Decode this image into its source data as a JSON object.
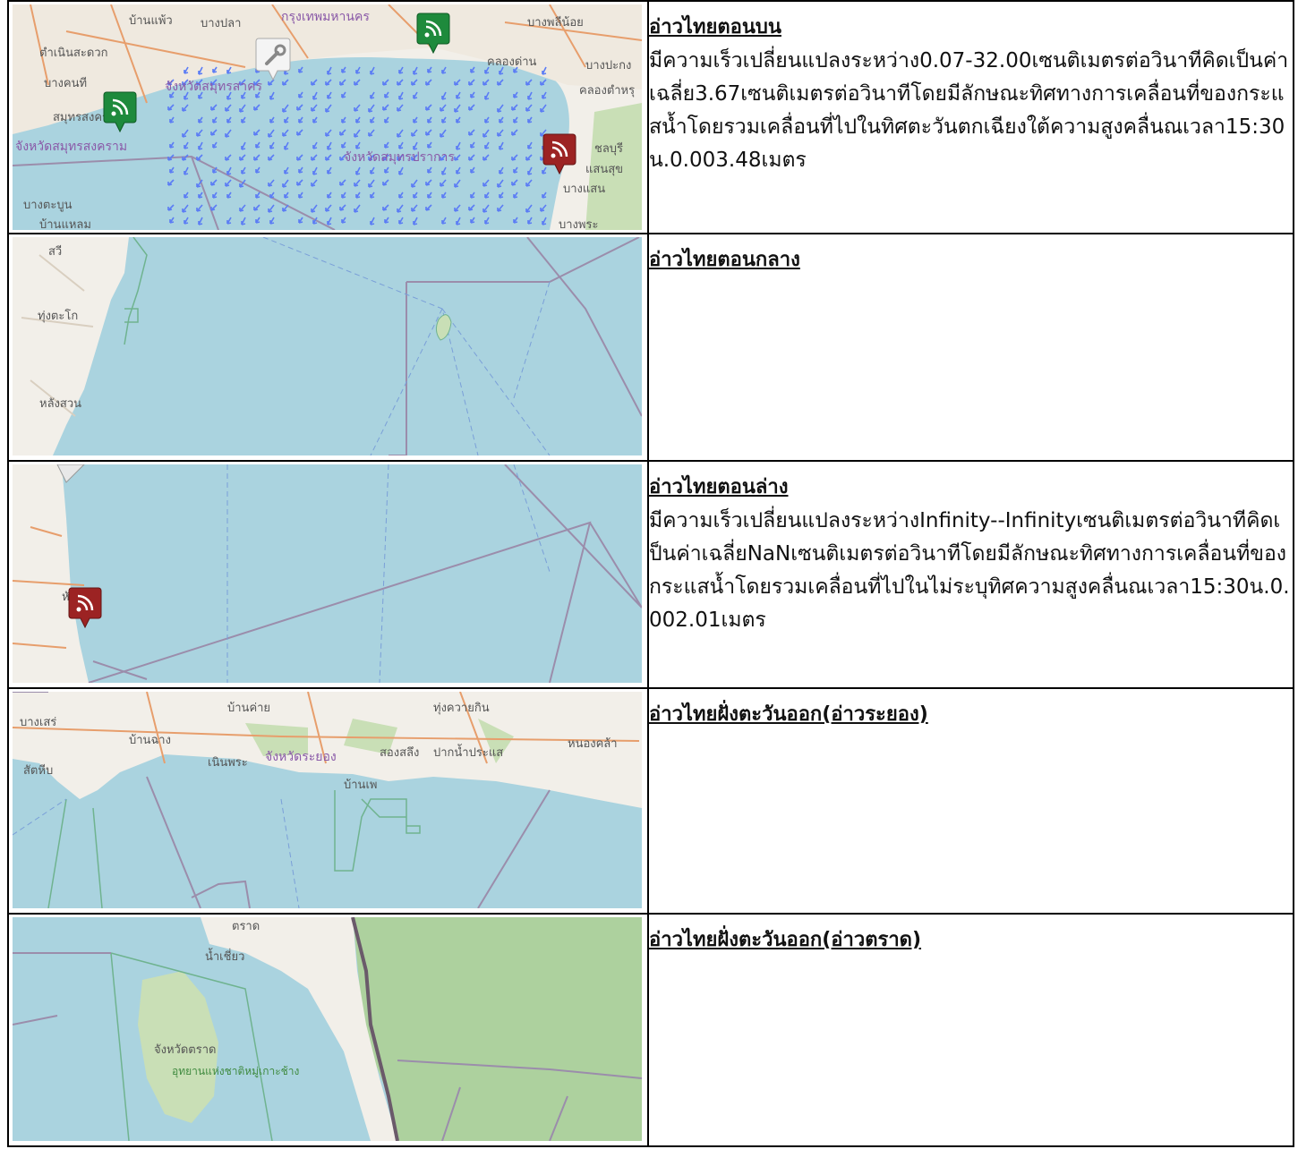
{
  "rows": [
    {
      "title": "อ่าวไทยตอนบน",
      "description": "มีความเร็วเปลี่ยนแปลงระหว่าง0.07-32.00เซนติเมตรต่อวินาทีคิดเป็นค่าเฉลี่ย3.67เซนติเมตรต่อวินาทีโดยมีลักษณะทิศทางการเคลื่อนที่ของกระแสน้ำโดยรวมเคลื่อนที่ไปในทิศตะวันตกเฉียงใต้ความสูงคลื่นณเวลา15:30น.0.003.48เมตร",
      "map_labels": [
        "บ้านแพ้ว",
        "บางปลา",
        "กรุงเทพมหานคร",
        "บางพลีน้อย",
        "ตำเนินสะดวก",
        "คลองด่าน",
        "บางปะกง",
        "บางคนที",
        "จังหวัดสมุทรสาคร",
        "คลองตำหรุ",
        "สมุทรสงคราม",
        "จังหวัดสมุทรสงคราม",
        "จังหวัดสมุทรปราการ",
        "ชลบุรี",
        "แสนสุข",
        "บางแสน",
        "บางตะบูน",
        "บ้านแหลม",
        "บางพระ"
      ]
    },
    {
      "title": "อ่าวไทยตอนกลาง",
      "description": "",
      "map_labels": [
        "สวี",
        "ทุ่งตะโก",
        "หลังสวน"
      ]
    },
    {
      "title": "อ่าวไทยตอนล่าง",
      "description": "มีความเร็วเปลี่ยนแปลงระหว่างInfinity--Infinityเซนติเมตรต่อวินาทีคิดเป็นค่าเฉลี่ยNaNเซนติเมตรต่อวินาทีโดยมีลักษณะทิศทางการเคลื่อนที่ของกระแสน้ำโดยรวมเคลื่อนที่ไปในไม่ระบุทิศความสูงคลื่นณเวลา15:30น.0.002.01เมตร",
      "map_labels": [
        "หัวไทร"
      ]
    },
    {
      "title": "อ่าวไทยฝั่งตะวันออก(อ่าวระยอง)",
      "description": "",
      "map_labels": [
        "บางเสร่",
        "บ้านค่าย",
        "ทุ่งควายกิน",
        "บ้านฉาง",
        "หนองคล้า",
        "สองสลึง",
        "ปากน้ำประแส",
        "สัตหีบ",
        "เนินพระ",
        "จังหวัดระยอง",
        "บ้านเพ"
      ]
    },
    {
      "title": "อ่าวไทยฝั่งตะวันออก(อ่าวตราด)",
      "description": "",
      "map_labels": [
        "ตราด",
        "น้ำเชี่ยว",
        "จังหวัดตราด",
        "อุทยานแห่งชาติหมู่เกาะช้าง"
      ]
    }
  ],
  "colors": {
    "sea": "#aad3df",
    "land": "#f2efe9",
    "forest": "#add19e",
    "current_arrow": "#5b7cf5",
    "station_green": "#1e8a3c",
    "station_red": "#9c2323"
  },
  "icons": [
    "rss-icon",
    "wrench-icon",
    "map-pin-icon"
  ]
}
